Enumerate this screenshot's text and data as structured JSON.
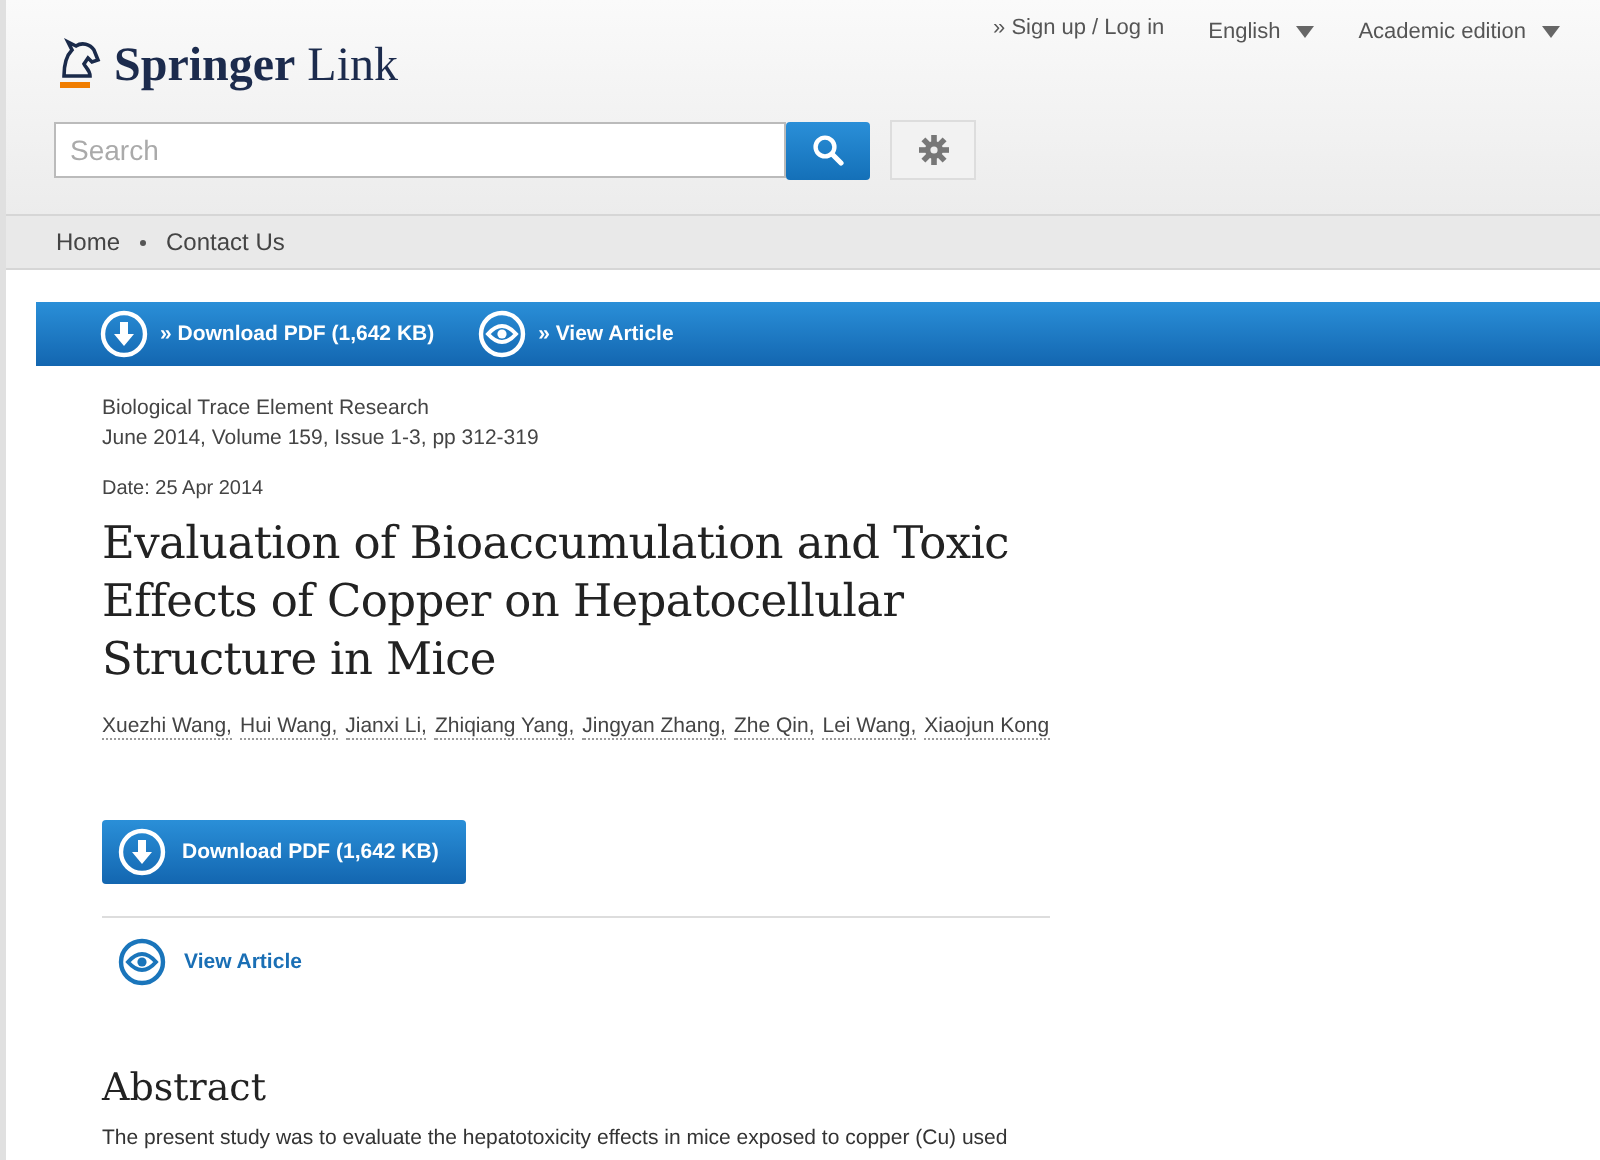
{
  "header": {
    "logo": "**Springer** Link",
    "account_link": "» Sign up / Log in",
    "menus": [
      {
        "label": "English"
      },
      {
        "label": "Academic edition"
      }
    ],
    "search": {
      "placeholder": "Search"
    }
  },
  "nav": {
    "items": [
      "Home",
      "Contact Us"
    ]
  },
  "action_bar": {
    "download": "» Download PDF (1,642 KB)",
    "view": "» View Article"
  },
  "article": {
    "journal": "Biological Trace Element Research",
    "issue": "June 2014, Volume 159, Issue 1-3, pp 312-319",
    "date": "Date: 25 Apr 2014",
    "title": "Evaluation of Bioaccumulation and Toxic Effects of Copper on Hepatocellular Structure in Mice",
    "authors": [
      "Xuezhi Wang,",
      "Hui Wang,",
      "Jianxi Li,",
      "Zhiqiang Yang,",
      "Jingyan Zhang,",
      "Zhe Qin,",
      "Lei Wang,",
      "Xiaojun Kong"
    ],
    "download_button": "Download PDF (1,642 KB)",
    "view_link": "View Article",
    "abstract_heading": "Abstract",
    "abstract_text": "The present study was to evaluate the hepatotoxicity effects in mice exposed to copper (Cu) used"
  }
}
